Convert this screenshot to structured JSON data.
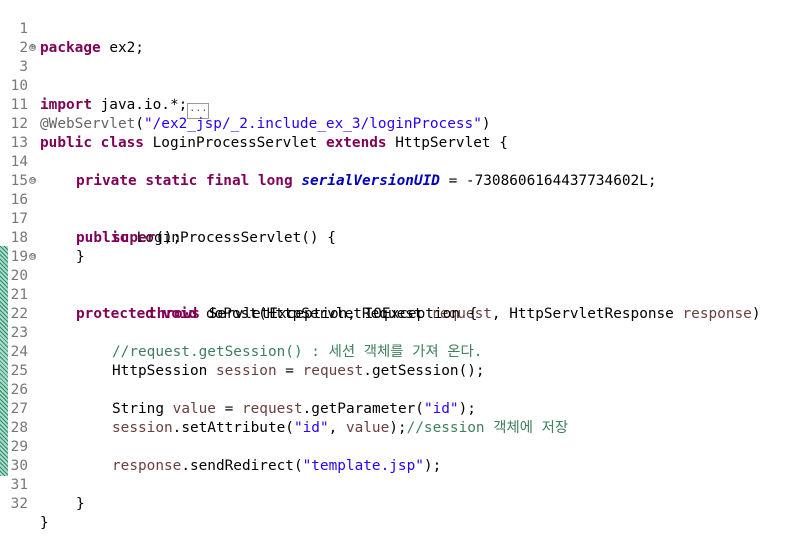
{
  "editor": {
    "line_numbers": [
      "1",
      "2",
      "3",
      "10",
      "11",
      "12",
      "13",
      "14",
      "15",
      "16",
      "17",
      "18",
      "19",
      "20",
      "21",
      "22",
      "23",
      "24",
      "25",
      "26",
      "27",
      "28",
      "29",
      "30",
      "31",
      "32"
    ],
    "fold_symbols": {
      "expand": "⊕",
      "collapse": "⊖"
    },
    "tokens": {
      "package": "package",
      "pkg_name": " ex2;",
      "import": "import",
      "import_path": " java.io.*;",
      "fold_dots": "...",
      "annotation": "@WebServlet",
      "ann_open": "(",
      "ann_value": "\"/ex2_jsp/_2.include_ex_3/loginProcess\"",
      "ann_close": ")",
      "public": "public",
      "class": "class",
      "class_name": " LoginProcessServlet ",
      "extends": "extends",
      "super_class": " HttpServlet {",
      "private": "private",
      "static": "static",
      "final": "final",
      "long": "long",
      "serial_name": "serialVersionUID",
      "serial_value": " = -7308606164437734602L;",
      "constructor": " LoginProcessServlet() {",
      "super": "super",
      "super_call": "();",
      "close_brace": "}",
      "protected": "protected",
      "void": "void",
      "method_sig_1": " doPost(HttpServletRequest ",
      "param_request": "request",
      "method_sig_2": ", HttpServletResponse ",
      "param_response": "response",
      "method_sig_3": ")",
      "throws": "throws",
      "exceptions": " ServletException, IOException {",
      "comment_1": "//request.getSession() : 세션 객체를 가져 온다.",
      "session_type": "HttpSession ",
      "var_session": "session",
      "session_assign": " = ",
      "var_request": "request",
      "get_session_call": ".getSession();",
      "string_type": "String ",
      "var_value": "value",
      "get_param_call": ".getParameter(",
      "str_id": "\"id\"",
      "close_paren_semi": ");",
      "set_attr_call": ".setAttribute(",
      "comma_space": ", ",
      "comment_2": "//session 객체에 저장",
      "var_response": "response",
      "redirect_call": ".sendRedirect(",
      "str_template": "\"template.jsp\"",
      "final_brace": "}"
    }
  }
}
